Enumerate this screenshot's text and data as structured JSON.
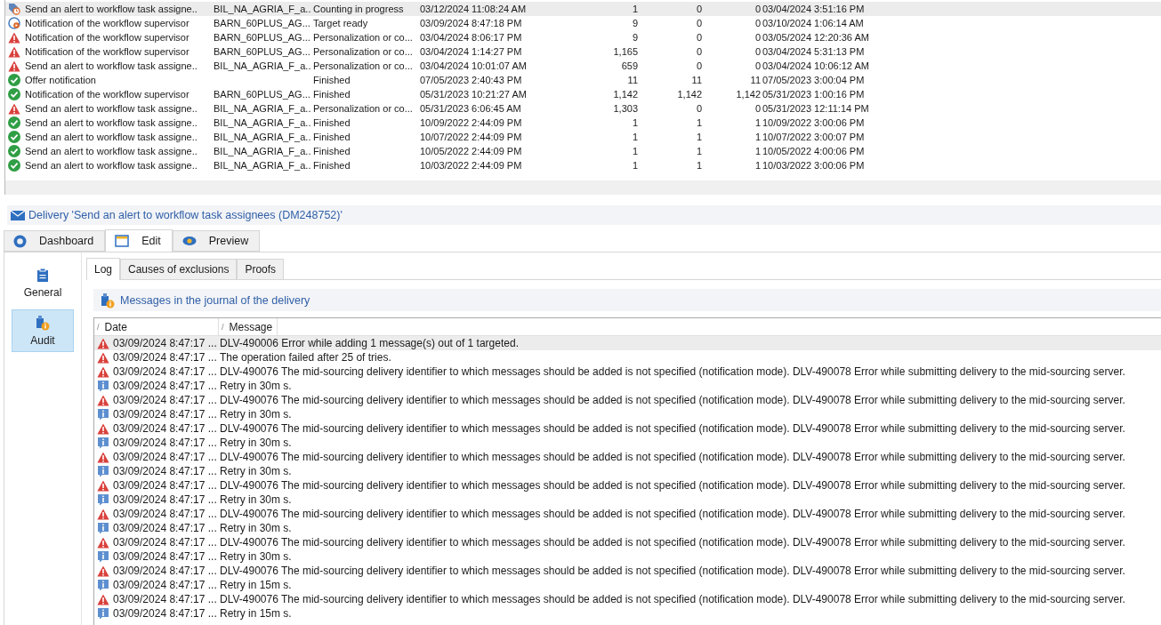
{
  "deliveries": [
    {
      "kind": "counting",
      "name": "Send an alert to workflow task assigne..",
      "label": "BIL_NA_AGRIA_F_a..",
      "status": "Counting in progress",
      "created": "03/12/2024 11:08:24 AM",
      "count_1": "1",
      "count_2": "0",
      "count_3": "0",
      "updated": "03/04/2024 3:51:16 PM",
      "selected": true
    },
    {
      "kind": "target",
      "name": "Notification of the workflow supervisor",
      "label": "BARN_60PLUS_AG...",
      "status": "Target ready",
      "created": "03/09/2024 8:47:18 PM",
      "count_1": "9",
      "count_2": "0",
      "count_3": "0",
      "updated": "03/10/2024 1:06:14 AM",
      "selected": false
    },
    {
      "kind": "error",
      "name": "Notification of the workflow supervisor",
      "label": "BARN_60PLUS_AG...",
      "status": "Personalization or co...",
      "created": "03/04/2024 8:06:17 PM",
      "count_1": "9",
      "count_2": "0",
      "count_3": "0",
      "updated": "03/05/2024 12:20:36 AM",
      "selected": false
    },
    {
      "kind": "error",
      "name": "Notification of the workflow supervisor",
      "label": "BARN_60PLUS_AG...",
      "status": "Personalization or co...",
      "created": "03/04/2024 1:14:27 PM",
      "count_1": "1,165",
      "count_2": "0",
      "count_3": "0",
      "updated": "03/04/2024 5:31:13 PM",
      "selected": false
    },
    {
      "kind": "error",
      "name": "Send an alert to workflow task assigne..",
      "label": "BIL_NA_AGRIA_F_a..",
      "status": "Personalization or co...",
      "created": "03/04/2024 10:01:07 AM",
      "count_1": "659",
      "count_2": "0",
      "count_3": "0",
      "updated": "03/04/2024 10:06:12 AM",
      "selected": false
    },
    {
      "kind": "finished",
      "name": "Offer notification",
      "status": "Finished",
      "created": "07/05/2023 2:40:43 PM",
      "count_1": "11",
      "count_2": "11",
      "count_3": "11",
      "updated": "07/05/2023 3:00:04 PM",
      "selected": false
    },
    {
      "kind": "finished",
      "name": "Notification of the workflow supervisor",
      "label": "BARN_60PLUS_AG...",
      "status": "Finished",
      "created": "05/31/2023 10:21:27 AM",
      "count_1": "1,142",
      "count_2": "1,142",
      "count_3": "1,142",
      "updated": "05/31/2023 1:00:16 PM",
      "selected": false
    },
    {
      "kind": "error",
      "name": "Send an alert to workflow task assigne..",
      "label": "BIL_NA_AGRIA_F_a..",
      "status": "Personalization or co...",
      "created": "05/31/2023 6:06:45 AM",
      "count_1": "1,303",
      "count_2": "0",
      "count_3": "0",
      "updated": "05/31/2023 12:11:14 PM",
      "selected": false
    },
    {
      "kind": "finished",
      "name": "Send an alert to workflow task assigne..",
      "label": "BIL_NA_AGRIA_F_a..",
      "status": "Finished",
      "created": "10/09/2022 2:44:09 PM",
      "count_1": "1",
      "count_2": "1",
      "count_3": "1",
      "updated": "10/09/2022 3:00:06 PM",
      "selected": false
    },
    {
      "kind": "finished",
      "name": "Send an alert to workflow task assigne..",
      "label": "BIL_NA_AGRIA_F_a..",
      "status": "Finished",
      "created": "10/07/2022 2:44:09 PM",
      "count_1": "1",
      "count_2": "1",
      "count_3": "1",
      "updated": "10/07/2022 3:00:07 PM",
      "selected": false
    },
    {
      "kind": "finished",
      "name": "Send an alert to workflow task assigne..",
      "label": "BIL_NA_AGRIA_F_a..",
      "status": "Finished",
      "created": "10/05/2022 2:44:09 PM",
      "count_1": "1",
      "count_2": "1",
      "count_3": "1",
      "updated": "10/05/2022 4:00:06 PM",
      "selected": false
    },
    {
      "kind": "finished",
      "name": "Send an alert to workflow task assigne..",
      "label": "BIL_NA_AGRIA_F_a..",
      "status": "Finished",
      "created": "10/03/2022 2:44:09 PM",
      "count_1": "1",
      "count_2": "1",
      "count_3": "1",
      "updated": "10/03/2022 3:00:06 PM",
      "selected": false
    }
  ],
  "delivery_title": "Delivery 'Send an alert to workflow task assignees (DM248752)'",
  "tabs": [
    {
      "label": "Dashboard",
      "selected": false
    },
    {
      "label": "Edit",
      "selected": true
    },
    {
      "label": "Preview",
      "selected": false
    }
  ],
  "sidebar": [
    {
      "label": "General",
      "selected": false
    },
    {
      "label": "Audit",
      "selected": true
    }
  ],
  "sub_tabs": [
    {
      "label": "Log",
      "selected": true
    },
    {
      "label": "Causes of exclusions",
      "selected": false
    },
    {
      "label": "Proofs",
      "selected": false
    }
  ],
  "journal_title": "Messages in the journal of the delivery",
  "log": {
    "columns": [
      {
        "sort_mark": "/",
        "label": "Date"
      },
      {
        "sort_mark": "/",
        "label": "Message"
      }
    ],
    "rows": [
      {
        "kind": "error",
        "date": "03/09/2024 8:47:17 ...",
        "message": "DLV-490006 Error while adding 1 message(s) out of 1 targeted.",
        "selected": true
      },
      {
        "kind": "error",
        "date": "03/09/2024 8:47:17 ...",
        "message": "The operation failed after 25 of tries.",
        "selected": false
      },
      {
        "kind": "error",
        "date": "03/09/2024 8:47:17 ...",
        "message": "DLV-490076 The mid-sourcing delivery identifier to which messages should be added is not specified (notification mode). DLV-490078 Error while submitting delivery to the mid-sourcing server.",
        "selected": false
      },
      {
        "kind": "info",
        "date": "03/09/2024 8:47:17 ...",
        "message": "Retry in 30m s.",
        "selected": false
      },
      {
        "kind": "error",
        "date": "03/09/2024 8:47:17 ...",
        "message": "DLV-490076 The mid-sourcing delivery identifier to which messages should be added is not specified (notification mode). DLV-490078 Error while submitting delivery to the mid-sourcing server.",
        "selected": false
      },
      {
        "kind": "info",
        "date": "03/09/2024 8:47:17 ...",
        "message": "Retry in 30m s.",
        "selected": false
      },
      {
        "kind": "error",
        "date": "03/09/2024 8:47:17 ...",
        "message": "DLV-490076 The mid-sourcing delivery identifier to which messages should be added is not specified (notification mode). DLV-490078 Error while submitting delivery to the mid-sourcing server.",
        "selected": false
      },
      {
        "kind": "info",
        "date": "03/09/2024 8:47:17 ...",
        "message": "Retry in 30m s.",
        "selected": false
      },
      {
        "kind": "error",
        "date": "03/09/2024 8:47:17 ...",
        "message": "DLV-490076 The mid-sourcing delivery identifier to which messages should be added is not specified (notification mode). DLV-490078 Error while submitting delivery to the mid-sourcing server.",
        "selected": false
      },
      {
        "kind": "info",
        "date": "03/09/2024 8:47:17 ...",
        "message": "Retry in 30m s.",
        "selected": false
      },
      {
        "kind": "error",
        "date": "03/09/2024 8:47:17 ...",
        "message": "DLV-490076 The mid-sourcing delivery identifier to which messages should be added is not specified (notification mode). DLV-490078 Error while submitting delivery to the mid-sourcing server.",
        "selected": false
      },
      {
        "kind": "info",
        "date": "03/09/2024 8:47:17 ...",
        "message": "Retry in 30m s.",
        "selected": false
      },
      {
        "kind": "error",
        "date": "03/09/2024 8:47:17 ...",
        "message": "DLV-490076 The mid-sourcing delivery identifier to which messages should be added is not specified (notification mode). DLV-490078 Error while submitting delivery to the mid-sourcing server.",
        "selected": false
      },
      {
        "kind": "info",
        "date": "03/09/2024 8:47:17 ...",
        "message": "Retry in 30m s.",
        "selected": false
      },
      {
        "kind": "error",
        "date": "03/09/2024 8:47:17 ...",
        "message": "DLV-490076 The mid-sourcing delivery identifier to which messages should be added is not specified (notification mode). DLV-490078 Error while submitting delivery to the mid-sourcing server.",
        "selected": false
      },
      {
        "kind": "info",
        "date": "03/09/2024 8:47:17 ...",
        "message": "Retry in 30m s.",
        "selected": false
      },
      {
        "kind": "error",
        "date": "03/09/2024 8:47:17 ...",
        "message": "DLV-490076 The mid-sourcing delivery identifier to which messages should be added is not specified (notification mode). DLV-490078 Error while submitting delivery to the mid-sourcing server.",
        "selected": false
      },
      {
        "kind": "info",
        "date": "03/09/2024 8:47:17 ...",
        "message": "Retry in 15m s.",
        "selected": false
      },
      {
        "kind": "error",
        "date": "03/09/2024 8:47:17 ...",
        "message": "DLV-490076 The mid-sourcing delivery identifier to which messages should be added is not specified (notification mode). DLV-490078 Error while submitting delivery to the mid-sourcing server.",
        "selected": false
      },
      {
        "kind": "info",
        "date": "03/09/2024 8:47:17 ...",
        "message": "Retry in 15m s.",
        "selected": false
      }
    ]
  }
}
